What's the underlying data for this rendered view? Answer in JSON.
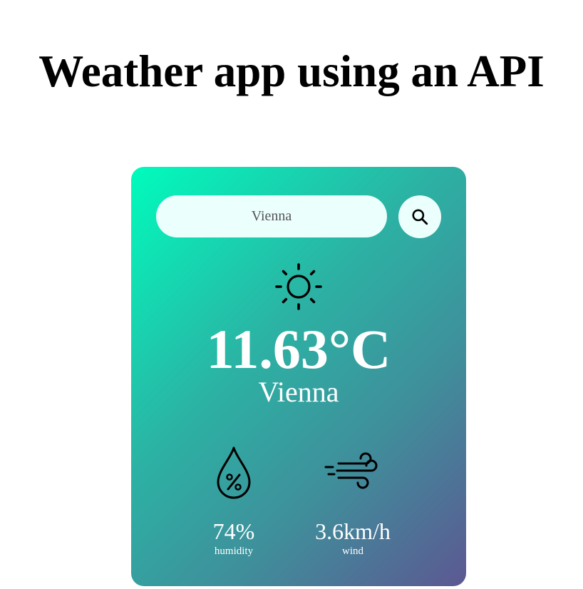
{
  "page": {
    "title": "Weather app using an API"
  },
  "search": {
    "value": "Vienna",
    "button_icon": "search-icon"
  },
  "weather": {
    "icon": "sun-icon",
    "temperature": "11.63°C",
    "city": "Vienna"
  },
  "details": {
    "humidity": {
      "icon": "humidity-drop-icon",
      "value": "74%",
      "label": "humidity"
    },
    "wind": {
      "icon": "wind-icon",
      "value": "3.6km/h",
      "label": "wind"
    }
  },
  "colors": {
    "card_gradient_start": "#00fcbd",
    "card_gradient_end": "#5c5892",
    "input_background": "#ebfffc",
    "text_on_card": "#ffffff"
  }
}
